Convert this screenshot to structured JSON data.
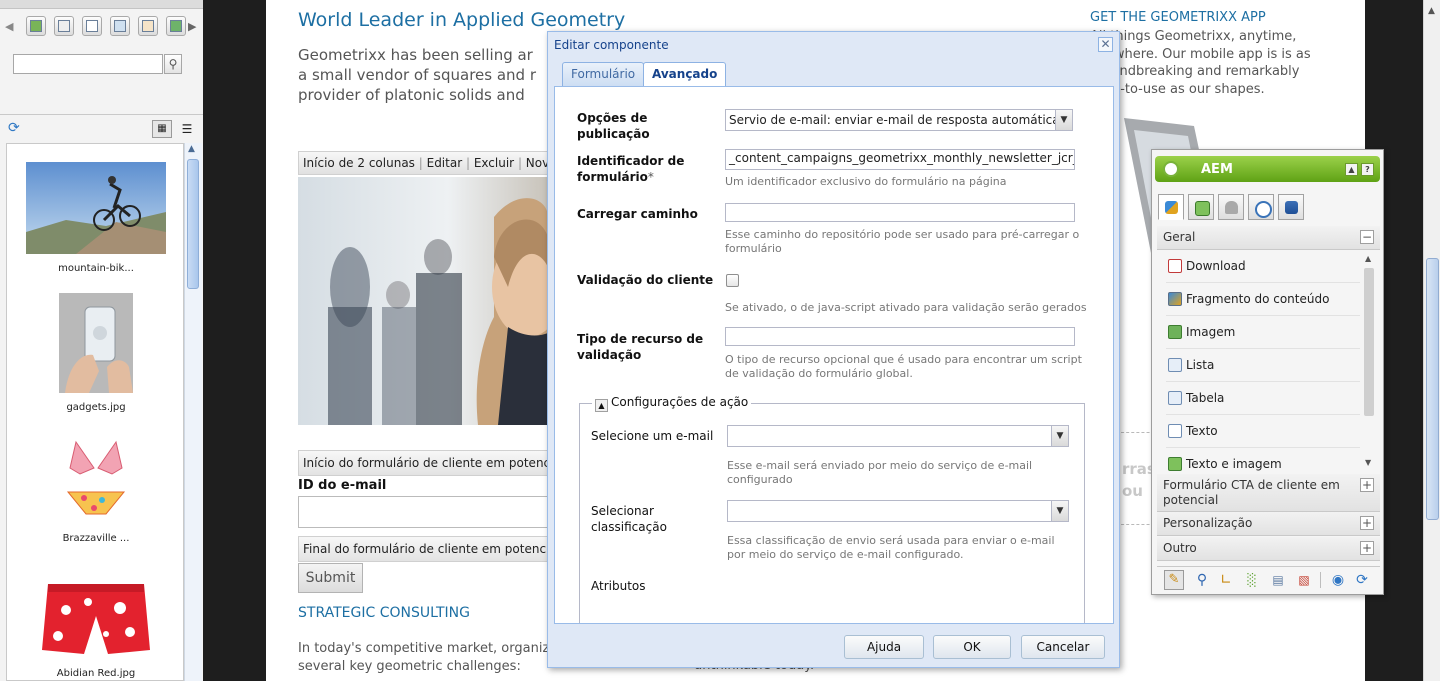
{
  "finder": {
    "toolbar_icons": [
      "back-arrow-icon",
      "image-icon",
      "document-icon",
      "page-icon",
      "paragraph-icon",
      "product-icon",
      "manuscript-icon",
      "forward-arrow-icon"
    ],
    "search": {
      "value": "",
      "placeholder": ""
    },
    "assets": [
      {
        "label": "mountain-bik...",
        "image": "mountain-biker"
      },
      {
        "label": "gadgets.jpg",
        "image": "hand-holding-phone"
      },
      {
        "label": "Brazzaville ...",
        "image": "bikini"
      },
      {
        "label": "Abidian Red.jpg",
        "image": "red-shorts"
      }
    ]
  },
  "page": {
    "heading": "World Leader in Applied Geometry",
    "intro_lines": [
      "Geometrixx has been selling ar",
      "a small vendor of squares and r",
      "provider of platonic solids and"
    ],
    "column_bar": [
      "Início de 2 colunas",
      "Editar",
      "Excluir",
      "Novo..."
    ],
    "form_start": "Início do formulário de cliente em potencial",
    "email_label": "ID do e-mail",
    "form_end": "Final do formulário de cliente em potencial",
    "submit": "Submit",
    "section_title": "STRATEGIC CONSULTING",
    "section_lines": [
      "In today's competitive market, organiza",
      "several key geometric challenges:"
    ],
    "section_trailing": "unthinkable today.",
    "app_title": "GET THE GEOMETRIXX APP",
    "app_lines": [
      "All things Geometrixx, anytime,",
      "anywhere. Our mobile app is is as",
      "groundbreaking and remarkably",
      "easy-to-use as our shapes."
    ],
    "ghost_lines": [
      "rras",
      "ou"
    ]
  },
  "dialog": {
    "title": "Editar componente",
    "tabs": [
      "Formulário",
      "Avançado"
    ],
    "active_tab": "Avançado",
    "publish_options": {
      "label": "Opções de publicação",
      "value": "Servio de e-mail: enviar e-mail de resposta automática"
    },
    "form_id": {
      "label": "Identificador de formulário",
      "required_mark": "*",
      "value": "_content_campaigns_geometrixx_monthly_newsletter_jcr_",
      "help": "Um identificador exclusivo do formulário na página"
    },
    "load_path": {
      "label": "Carregar caminho",
      "value": "",
      "help": "Esse caminho do repositório pode ser usado para pré-carregar o formulário"
    },
    "client_validation": {
      "label": "Validação do cliente",
      "checked": false,
      "help": "Se ativado, o de java-script ativado para validação serão gerados"
    },
    "validation_resource": {
      "label": "Tipo de recurso de validação",
      "value": "",
      "help": "O tipo de recurso opcional que é usado para encontrar um script de validação do formulário global."
    },
    "action_fieldset": {
      "legend": "Configurações de ação",
      "email_select": {
        "label": "Selecione um e-mail",
        "value": "",
        "help": "Esse e-mail será enviado por meio do serviço de e-mail configurado"
      },
      "classification_select": {
        "label": "Selecionar classificação",
        "value": "",
        "help": "Essa classificação de envio será usada para enviar o e-mail por meio do serviço de e-mail configurado."
      },
      "attributes_label": "Atributos"
    },
    "buttons": {
      "help": "Ajuda",
      "ok": "OK",
      "cancel": "Cancelar"
    }
  },
  "sidekick": {
    "title": "AEM",
    "tabs": [
      "components-tab-icon",
      "page-tab-icon",
      "lock-tab-icon",
      "clock-tab-icon",
      "workflow-tab-icon"
    ],
    "group_general": "Geral",
    "items": [
      "Download",
      "Fragmento do conteúdo",
      "Imagem",
      "Lista",
      "Tabela",
      "Texto",
      "Texto e imagem"
    ],
    "groups": [
      "Formulário CTA de cliente em potencial",
      "Personalização",
      "Outro"
    ],
    "footer_icons": [
      "pencil-icon",
      "zoom-icon",
      "ruler-icon",
      "chart-icon",
      "document-icon",
      "palette-icon",
      "globe-icon",
      "refresh-icon"
    ]
  }
}
